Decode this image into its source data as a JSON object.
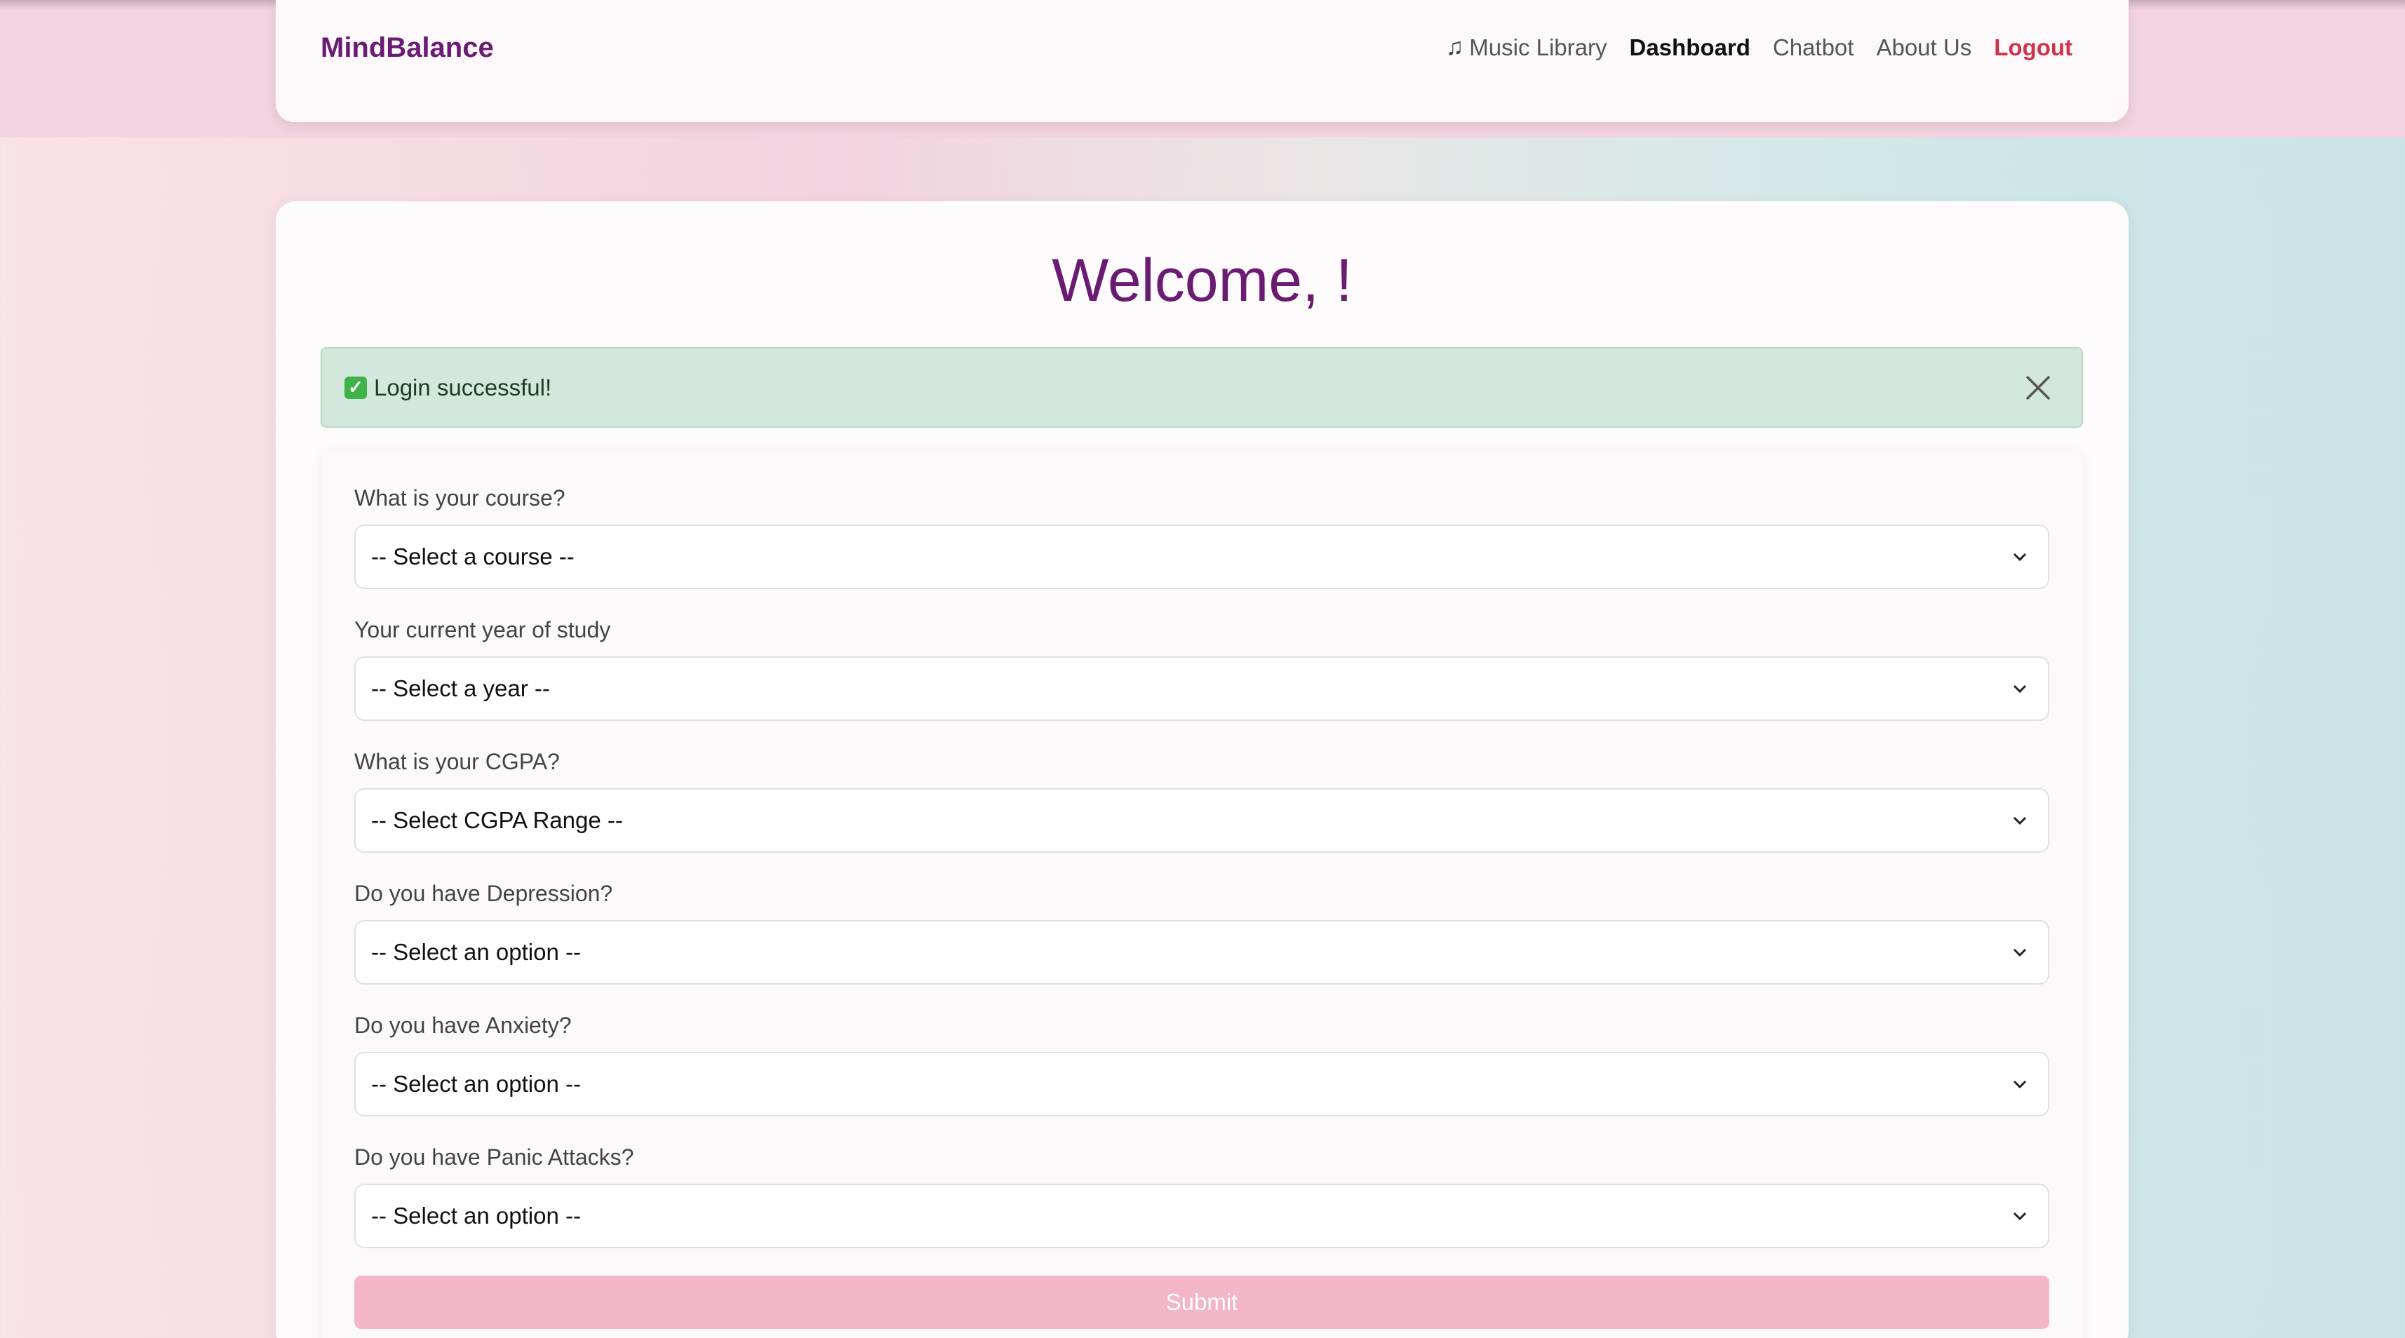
{
  "navbar": {
    "brand": "MindBalance",
    "links": [
      {
        "label": "Music Library",
        "icon": "music-note-icon"
      },
      {
        "label": "Dashboard"
      },
      {
        "label": "Chatbot"
      },
      {
        "label": "About Us"
      },
      {
        "label": "Logout"
      }
    ]
  },
  "main": {
    "title": "Welcome, !",
    "alert": {
      "icon": "check-icon",
      "text": "Login successful!"
    },
    "fields": [
      {
        "label": "What is your course?",
        "value": "-- Select a course --"
      },
      {
        "label": "Your current year of study",
        "value": "-- Select a year --"
      },
      {
        "label": "What is your CGPA?",
        "value": "-- Select CGPA Range --"
      },
      {
        "label": "Do you have Depression?",
        "value": "-- Select an option --"
      },
      {
        "label": "Do you have Anxiety?",
        "value": "-- Select an option --"
      },
      {
        "label": "Do you have Panic Attacks?",
        "value": "-- Select an option --"
      }
    ],
    "submit_label": "Submit"
  },
  "colors": {
    "brand": "#6a1b72",
    "logout": "#d1324a",
    "alert_bg": "#d3e8dd",
    "submit_bg": "#f2b6c6"
  }
}
